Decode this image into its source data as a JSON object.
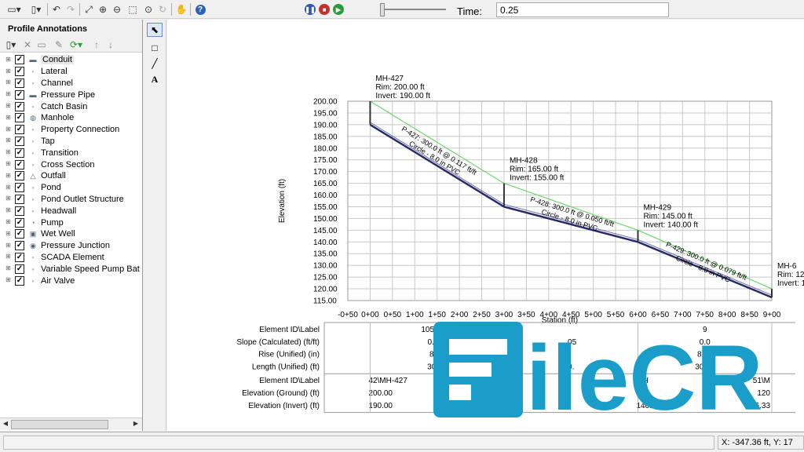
{
  "toolbar": {
    "time_label": "Time:",
    "time_value": "0.25",
    "buttons": [
      "layout-icon",
      "page-icon",
      "undo-icon",
      "redo-icon",
      "zoom-extents-icon",
      "zoom-in-icon",
      "zoom-out-icon",
      "zoom-window-icon",
      "zoom-realtime-icon",
      "zoom-previous-icon",
      "pan-icon",
      "help-icon"
    ],
    "playback": [
      "pause-icon",
      "stop-icon",
      "play-icon"
    ]
  },
  "panel": {
    "title": "Profile Annotations",
    "items": [
      {
        "label": "Conduit",
        "icon": "conduit-icon",
        "checked": true,
        "selected": true
      },
      {
        "label": "Lateral",
        "icon": "lateral-icon",
        "checked": true
      },
      {
        "label": "Channel",
        "icon": "channel-icon",
        "checked": true
      },
      {
        "label": "Pressure Pipe",
        "icon": "pressure-pipe-icon",
        "checked": true
      },
      {
        "label": "Catch Basin",
        "icon": "catch-basin-icon",
        "checked": true
      },
      {
        "label": "Manhole",
        "icon": "manhole-icon",
        "checked": true
      },
      {
        "label": "Property Connection",
        "icon": "property-connection-icon",
        "checked": true
      },
      {
        "label": "Tap",
        "icon": "tap-icon",
        "checked": true
      },
      {
        "label": "Transition",
        "icon": "transition-icon",
        "checked": true
      },
      {
        "label": "Cross Section",
        "icon": "cross-section-icon",
        "checked": true
      },
      {
        "label": "Outfall",
        "icon": "outfall-icon",
        "checked": true
      },
      {
        "label": "Pond",
        "icon": "pond-icon",
        "checked": true
      },
      {
        "label": "Pond Outlet Structure",
        "icon": "pond-outlet-icon",
        "checked": true
      },
      {
        "label": "Headwall",
        "icon": "headwall-icon",
        "checked": true
      },
      {
        "label": "Pump",
        "icon": "pump-icon",
        "checked": true
      },
      {
        "label": "Wet Well",
        "icon": "wet-well-icon",
        "checked": true
      },
      {
        "label": "Pressure Junction",
        "icon": "pressure-junction-icon",
        "checked": true
      },
      {
        "label": "SCADA Element",
        "icon": "scada-icon",
        "checked": true
      },
      {
        "label": "Variable Speed Pump Bat",
        "icon": "vsp-battery-icon",
        "checked": true
      },
      {
        "label": "Air Valve",
        "icon": "air-valve-icon",
        "checked": true
      }
    ]
  },
  "chart_data": {
    "type": "line",
    "ylabel": "Elevation (ft)",
    "xlabel": "Station (ft)",
    "ylim": [
      115,
      200
    ],
    "yticks": [
      "200.00",
      "195.00",
      "190.00",
      "185.00",
      "180.00",
      "175.00",
      "170.00",
      "165.00",
      "160.00",
      "155.00",
      "150.00",
      "145.00",
      "140.00",
      "135.00",
      "130.00",
      "125.00",
      "120.00",
      "115.00"
    ],
    "xlim": [
      -50,
      900
    ],
    "xticks": [
      "-0+50",
      "0+00",
      "0+50",
      "1+00",
      "1+50",
      "2+00",
      "2+50",
      "3+00",
      "3+50",
      "4+00",
      "4+50",
      "5+00",
      "5+50",
      "6+00",
      "6+50",
      "7+00",
      "7+50",
      "8+00",
      "8+50",
      "9+00"
    ],
    "grid": true,
    "series": [
      {
        "name": "ground",
        "x": [
          0,
          300,
          600,
          900
        ],
        "y": [
          200,
          165,
          145,
          120
        ]
      },
      {
        "name": "invert",
        "x": [
          0,
          300,
          600,
          900
        ],
        "y": [
          190,
          155,
          140,
          116.33
        ]
      }
    ],
    "nodes": [
      {
        "station": 0,
        "name": "MH-427",
        "rim": "Rim: 200.00 ft",
        "invert": "Invert: 190.00 ft"
      },
      {
        "station": 300,
        "name": "MH-428",
        "rim": "Rim: 165.00 ft",
        "invert": "Invert: 155.00 ft"
      },
      {
        "station": 600,
        "name": "MH-429",
        "rim": "Rim: 145.00 ft",
        "invert": "Invert: 140.00 ft"
      },
      {
        "station": 900,
        "name": "MH-6",
        "rim": "Rim: 12",
        "invert": "Invert: 1"
      }
    ],
    "pipes": [
      {
        "line1": "P-427: 300.0 ft @ 0.117 ft/ft",
        "line2": "Circle - 8.0 in PVC"
      },
      {
        "line1": "P-428: 300.0 ft @ 0.050 ft/ft",
        "line2": "Circle - 8.0 in PVC"
      },
      {
        "line1": "P-429: 300.0 ft @ 0.079 ft/ft",
        "line2": "Circle - 8.0 in PVC"
      }
    ]
  },
  "table": {
    "labels": [
      "Element ID\\Label",
      "Slope (Calculated) (ft/ft)",
      "Rise (Unified) (in)",
      "Length (Unified) (ft)",
      "Element ID\\Label",
      "Elevation (Ground) (ft)",
      "Elevation (Invert) (ft)"
    ],
    "pipe_cols": [
      [
        "105\\P-42",
        "0.117",
        "8.00",
        "300.0"
      ],
      [
        "",
        ".05",
        "",
        "0."
      ],
      [
        "9",
        "0.0",
        "8.00",
        "300.0"
      ]
    ],
    "node_cols": [
      [
        "42\\MH-427",
        "200.00",
        "190.00"
      ],
      [
        "MH",
        "145",
        "140.00"
      ],
      [
        "51\\M",
        "120",
        "116.33"
      ]
    ]
  },
  "status": {
    "coords": "X: -347.36 ft, Y: 17"
  },
  "watermark": "FileCR"
}
